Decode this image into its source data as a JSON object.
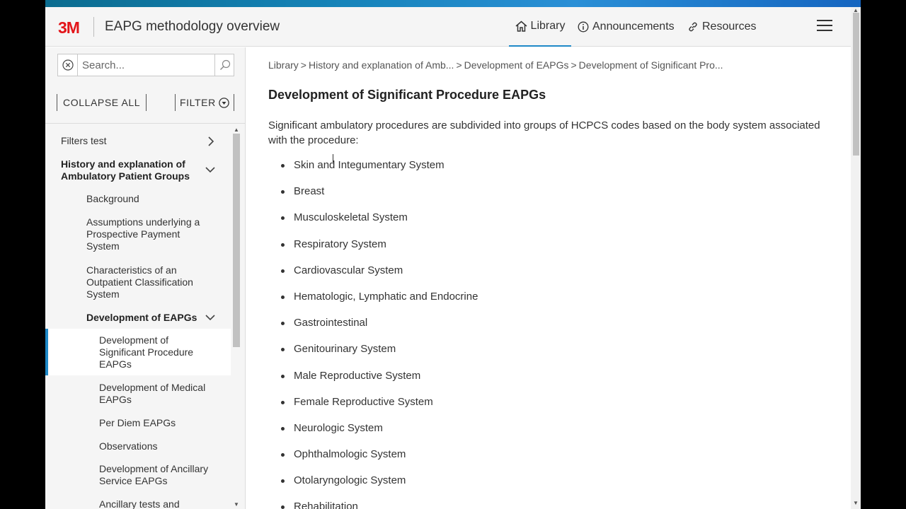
{
  "header": {
    "logo": "3M",
    "title": "EAPG methodology overview",
    "nav": {
      "library": "Library",
      "announcements": "Announcements",
      "resources": "Resources"
    }
  },
  "sidebar": {
    "search_placeholder": "Search...",
    "collapse_all": "COLLAPSE ALL",
    "filter": "FILTER",
    "items": [
      {
        "label": "Filters test"
      },
      {
        "label": "History and explanation of Ambulatory Patient Groups"
      },
      {
        "label": "Background"
      },
      {
        "label": "Assumptions underlying a Prospective Payment System"
      },
      {
        "label": "Characteristics of an Outpatient Classification System"
      },
      {
        "label": "Development of EAPGs"
      },
      {
        "label": "Development of Significant Procedure EAPGs"
      },
      {
        "label": "Development of Medical EAPGs"
      },
      {
        "label": "Per Diem EAPGs"
      },
      {
        "label": "Observations"
      },
      {
        "label": "Development of Ancillary Service EAPGs"
      },
      {
        "label": "Ancillary tests and"
      }
    ]
  },
  "breadcrumb": {
    "items": [
      "Library",
      "History and explanation of Amb...",
      "Development of EAPGs",
      "Development of Significant Pro..."
    ],
    "separator": ">"
  },
  "main": {
    "title": "Development of Significant Procedure EAPGs",
    "intro": "Significant ambulatory procedures are subdivided into groups of HCPCS codes based on the body system associated with the procedure:",
    "list": [
      "Skin and Integumentary System",
      "Breast",
      "Musculoskeletal System",
      "Respiratory System",
      "Cardiovascular System",
      "Hematologic, Lymphatic and Endocrine",
      "Gastrointestinal",
      "Genitourinary System",
      "Male Reproductive System",
      "Female Reproductive System",
      "Neurologic System",
      "Ophthalmologic System",
      "Otolaryngologic System",
      "Rehabilitation"
    ]
  },
  "colors": {
    "brand_red": "#e3151a",
    "accent_blue": "#1e88c7"
  }
}
